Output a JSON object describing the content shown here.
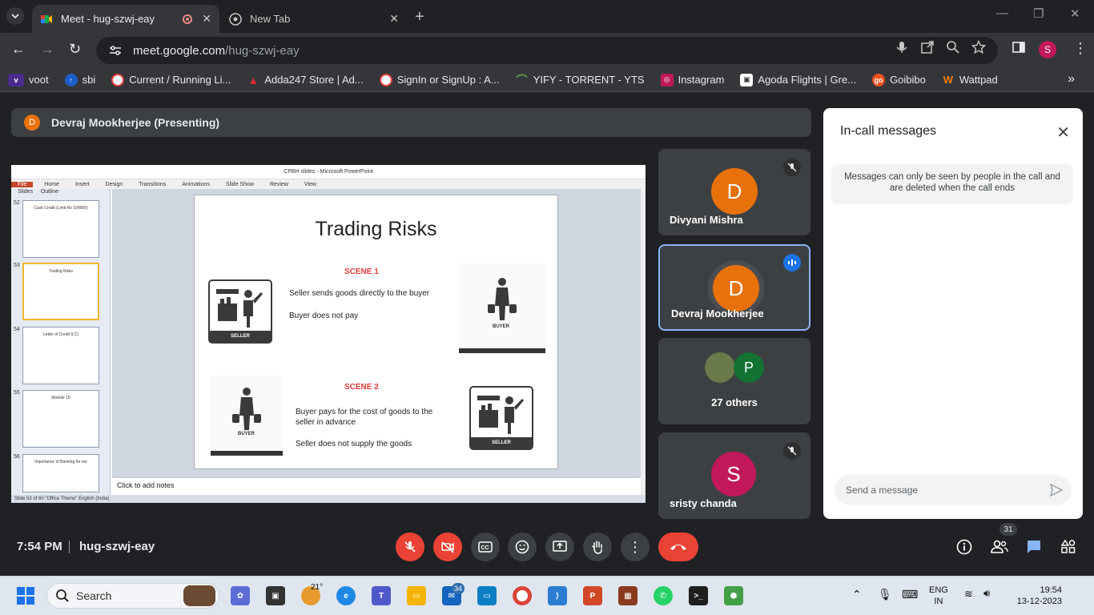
{
  "browser": {
    "tabs": [
      {
        "title": "Meet - hug-szwj-eay",
        "active": true
      },
      {
        "title": "New Tab",
        "active": false
      }
    ],
    "url_host": "meet.google.com",
    "url_path": "/hug-szwj-eay",
    "profile_initial": "S",
    "bookmarks": [
      {
        "label": "voot",
        "icon_color": "#4b2a8c"
      },
      {
        "label": "sbi",
        "icon_color": "#1a5ec9"
      },
      {
        "label": "Current / Running Li...",
        "icon_color": "#e53935"
      },
      {
        "label": "Adda247 Store | Ad...",
        "icon_color": "#d32f2f"
      },
      {
        "label": "SignIn or SignUp : A...",
        "icon_color": "#e53935"
      },
      {
        "label": "YIFY - TORRENT - YTS",
        "icon_color": "#6aa84f"
      },
      {
        "label": "Instagram",
        "icon_color": "#c2185b"
      },
      {
        "label": "Agoda Flights | Gre...",
        "icon_color": "#ffffff"
      },
      {
        "label": "Goibibo",
        "icon_color": "#f4511e"
      },
      {
        "label": "Wattpad",
        "icon_color": "#f57c00"
      }
    ]
  },
  "meet": {
    "presenter_initial": "D",
    "presenter_label": "Devraj Mookherjee (Presenting)",
    "participants": [
      {
        "name": "Divyani Mishra",
        "initial": "D",
        "color": "#e8710a",
        "muted": true
      },
      {
        "name": "Devraj Mookherjee",
        "initial": "D",
        "color": "#e8710a",
        "speaking": true
      },
      {
        "name": "27 others",
        "initial": "P",
        "color": "#137333"
      },
      {
        "name": "sristy chanda",
        "initial": "S",
        "color": "#c2185b",
        "muted": true
      }
    ],
    "messages": {
      "title": "In-call messages",
      "info": "Messages can only be seen by people in the call and are deleted when the call ends",
      "input_placeholder": "Send a message"
    },
    "time": "7:54 PM",
    "meeting_code": "hug-szwj-eay",
    "people_count": "31"
  },
  "presentation": {
    "window_title": "CPBH slides - Microsoft PowerPoint",
    "ribbon": [
      "File",
      "Home",
      "Insert",
      "Design",
      "Transitions",
      "Animations",
      "Slide Show",
      "Review",
      "View"
    ],
    "pane_tabs": [
      "Slides",
      "Outline"
    ],
    "thumbnails": [
      {
        "num": "52",
        "title": "Cash Credit (Limit Rs 100000)"
      },
      {
        "num": "53",
        "title": "Trading Risks",
        "selected": true
      },
      {
        "num": "54",
        "title": "Letter of Credit (LC)"
      },
      {
        "num": "55",
        "title": "Module 15"
      },
      {
        "num": "56",
        "title": "Importance of Banking for me"
      }
    ],
    "slide": {
      "title": "Trading Risks",
      "scene1_label": "SCENE 1",
      "scene1_line1": "Seller sends goods directly to the buyer",
      "scene1_line2": "Buyer does not pay",
      "scene2_label": "SCENE 2",
      "scene2_line1": "Buyer pays for the cost of goods to the seller in advance",
      "scene2_line2": "Seller does not supply the goods",
      "seller_caption": "SELLER",
      "buyer_caption": "BUYER"
    },
    "notes_placeholder": "Click to add notes",
    "status_bar": "Slide 53 of 60   \"Office Theme\"   English (India)"
  },
  "taskbar": {
    "search_label": "Search",
    "weather": "21°",
    "mail_badge": "34",
    "lang_line1": "ENG",
    "lang_line2": "IN",
    "time": "19:54",
    "date": "13-12-2023"
  }
}
